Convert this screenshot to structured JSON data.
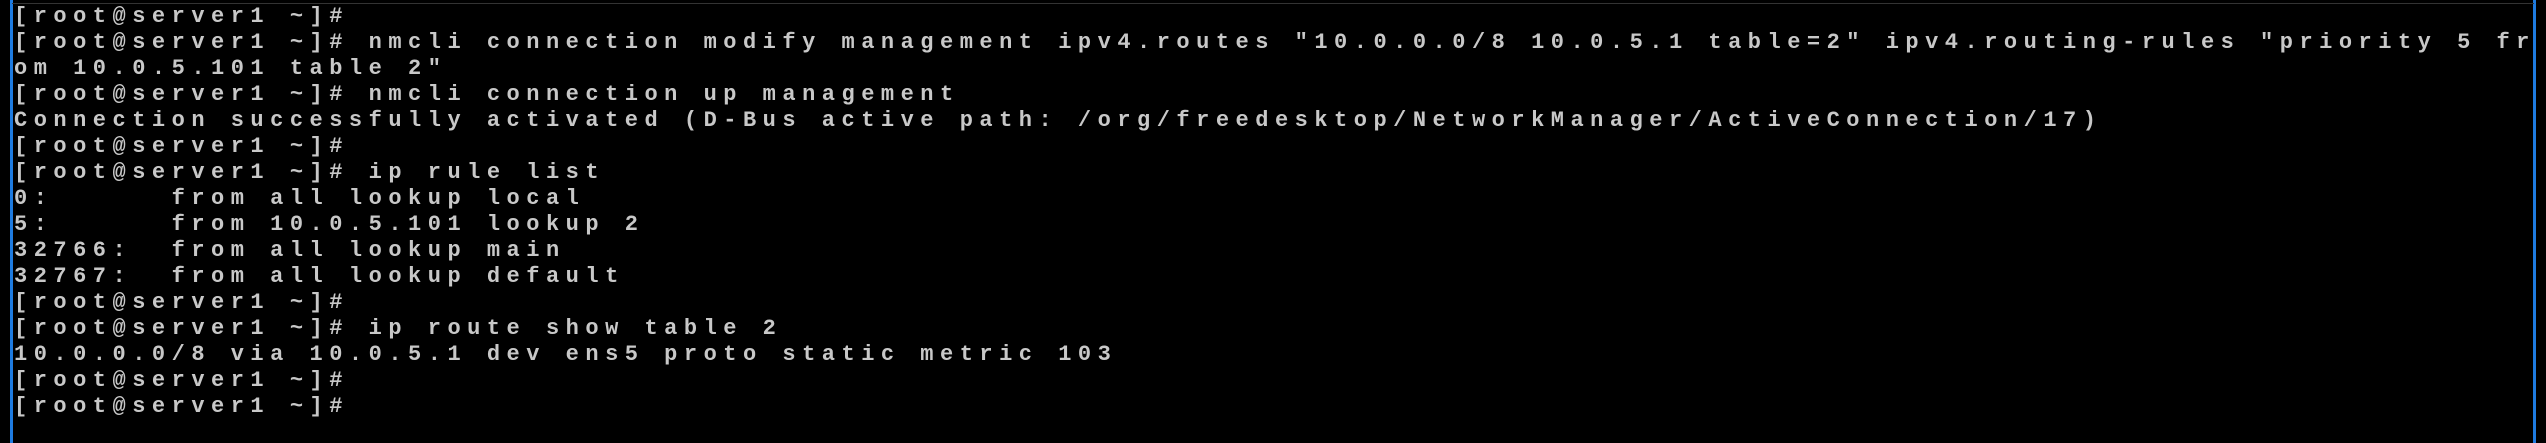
{
  "terminal": {
    "lines": [
      "[root@server1 ~]#",
      "[root@server1 ~]# nmcli connection modify management ipv4.routes \"10.0.0.0/8 10.0.5.1 table=2\" ipv4.routing-rules \"priority 5 fr",
      "om 10.0.5.101 table 2\"",
      "[root@server1 ~]# nmcli connection up management",
      "Connection successfully activated (D-Bus active path: /org/freedesktop/NetworkManager/ActiveConnection/17)",
      "[root@server1 ~]#",
      "[root@server1 ~]# ip rule list",
      "0:      from all lookup local",
      "5:      from 10.0.5.101 lookup 2",
      "32766:  from all lookup main",
      "32767:  from all lookup default",
      "[root@server1 ~]#",
      "[root@server1 ~]# ip route show table 2",
      "10.0.0.0/8 via 10.0.5.1 dev ens5 proto static metric 103",
      "[root@server1 ~]#",
      "[root@server1 ~]#"
    ]
  },
  "colors": {
    "text": "#c8c8c8",
    "background": "#000000",
    "border": "#1e7be0"
  }
}
